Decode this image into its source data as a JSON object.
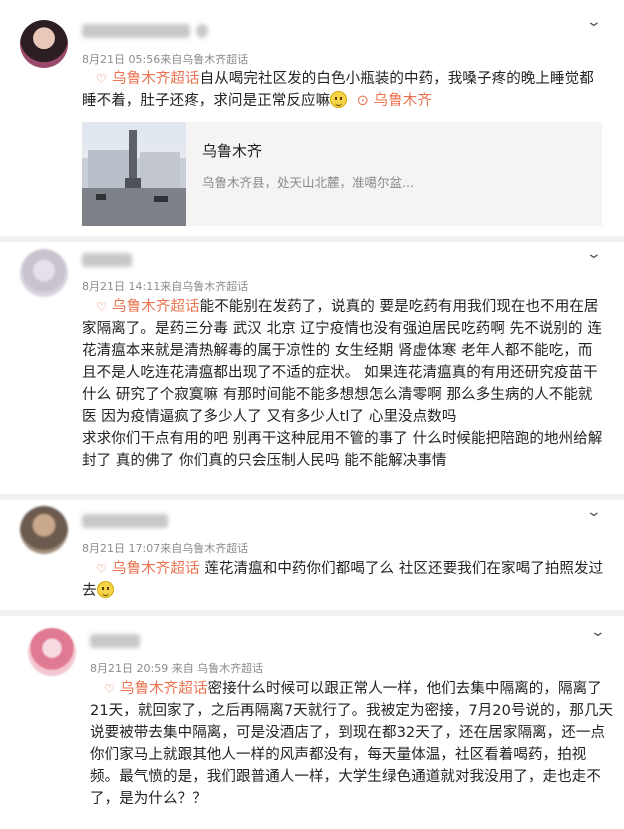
{
  "colors": {
    "accent": "#eb7350",
    "meta": "#8c8c8c"
  },
  "icons": {
    "super_topic": "super-topic-icon",
    "location": "location-pin-icon",
    "more": "chevron-down-icon"
  },
  "posts": [
    {
      "username": "",
      "meta": "8月21日 05:56来自乌鲁木齐超话",
      "topic": "乌鲁木齐超话",
      "lines": [
        "自从喝完社区发的白色小瓶装的中药，我嗓子疼的晚上睡觉都",
        "睡不着，肚子还疼，求问是正常反应嘛"
      ],
      "location": "乌鲁木齐",
      "card": {
        "title": "乌鲁木齐",
        "subtitle": "乌鲁木齐县，处天山北麓，准噶尔盆..."
      }
    },
    {
      "username": "",
      "meta": "8月21日 14:11来自乌鲁木齐超话",
      "topic": "乌鲁木齐超话",
      "lines": [
        "能不能别在发药了，说真的 要是吃药有用我们现在也不用在居",
        "家隔离了。是药三分毒 武汉 北京 辽宁疫情也没有强迫居民吃药啊 先不说别的 连",
        "花清瘟本来就是清热解毒的属于凉性的 女生经期 肾虚体寒 老年人都不能吃，而",
        "且不是人吃连花清瘟都出现了不适的症状。 如果连花清瘟真的有用还研究疫苗干",
        "什么 研究了个寂寞嘛 有那时间能不能多想想怎么清零啊 那么多生病的人不能就",
        "医 因为疫情逼疯了多少人了 又有多少人tl了 心里没点数吗",
        "求求你们干点有用的吧 别再干这种屁用不管的事了 什么时候能把陪跑的地州给解",
        "封了 真的佛了 你们真的只会压制人民吗 能不能解决事情"
      ]
    },
    {
      "username": "",
      "meta": "8月21日 17:07来自乌鲁木齐超话",
      "topic": "乌鲁木齐超话",
      "lines": [
        "  莲花清瘟和中药你们都喝了么 社区还要我们在家喝了拍照发过",
        "去"
      ]
    },
    {
      "username": "",
      "meta": "8月21日 20:59 来自 乌鲁木齐超话",
      "topic": "乌鲁木齐超话",
      "lines": [
        "密接什么时候可以跟正常人一样，他们去集中隔离的，隔离了",
        "21天，就回家了，之后再隔离7天就行了。我被定为密接，7月20号说的，那几天",
        "说要被带去集中隔离，可是没酒店了，到现在都32天了，还在居家隔离，还一点",
        "你们家马上就跟其他人一样的风声都没有，每天量体温，社区看着喝药，拍视",
        "频。最气愤的是，我们跟普通人一样，大学生绿色通道就对我没用了，走也走不",
        "了，是为什么？？"
      ]
    }
  ]
}
